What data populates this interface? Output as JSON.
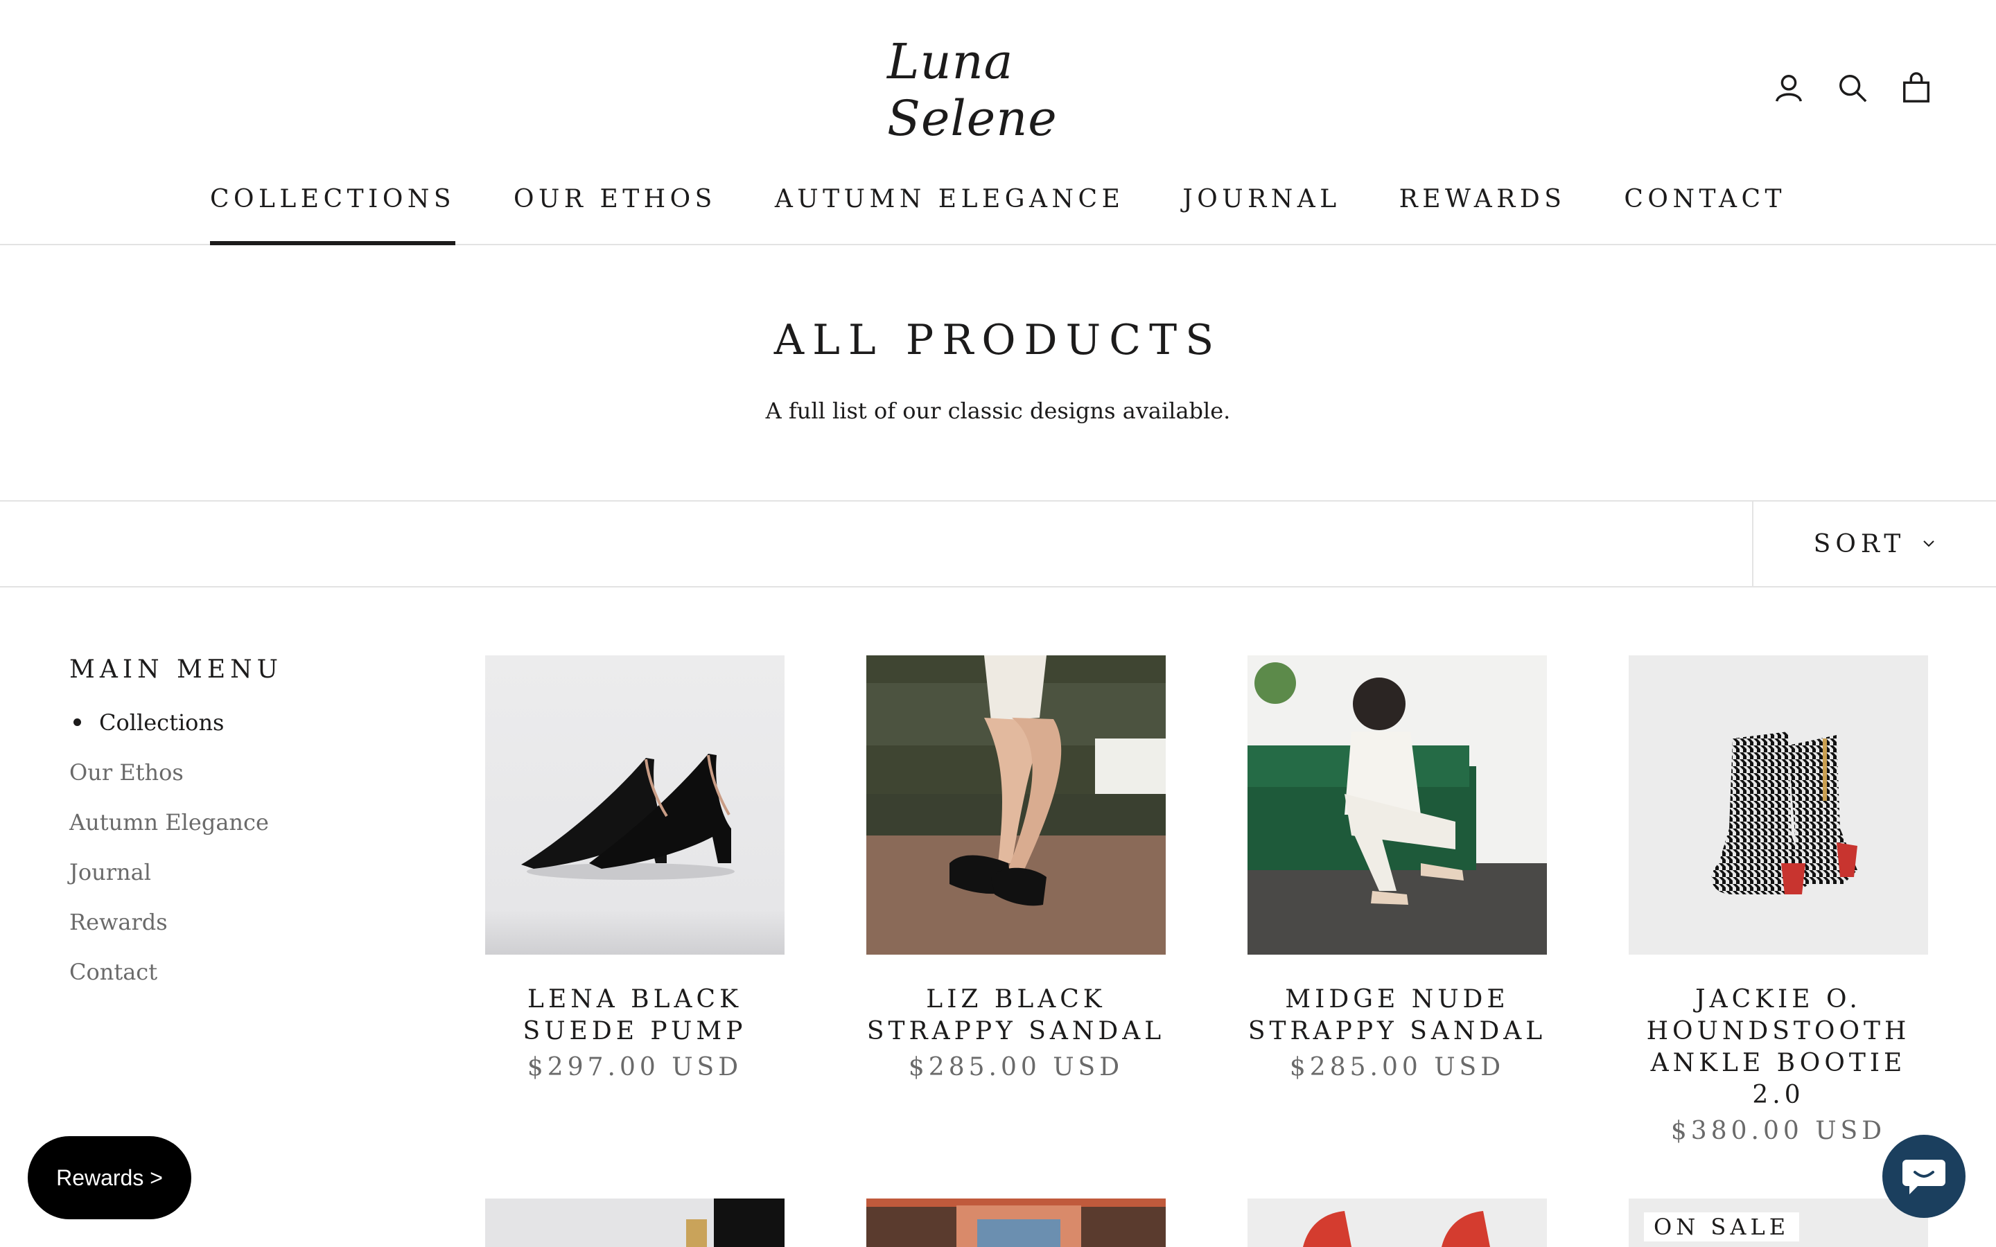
{
  "header": {
    "logo_text": "Luna Selene",
    "icons": [
      "account-icon",
      "search-icon",
      "cart-icon"
    ]
  },
  "nav": {
    "items": [
      {
        "label": "COLLECTIONS",
        "active": true
      },
      {
        "label": "OUR ETHOS",
        "active": false
      },
      {
        "label": "AUTUMN ELEGANCE",
        "active": false
      },
      {
        "label": "JOURNAL",
        "active": false
      },
      {
        "label": "REWARDS",
        "active": false
      },
      {
        "label": "CONTACT",
        "active": false
      }
    ]
  },
  "collection": {
    "title": "ALL PRODUCTS",
    "description": "A full list of our classic designs available."
  },
  "toolbar": {
    "sort_label": "SORT"
  },
  "sidebar": {
    "title": "MAIN MENU",
    "items": [
      {
        "label": "Collections",
        "active": true
      },
      {
        "label": "Our Ethos",
        "active": false
      },
      {
        "label": "Autumn Elegance",
        "active": false
      },
      {
        "label": "Journal",
        "active": false
      },
      {
        "label": "Rewards",
        "active": false
      },
      {
        "label": "Contact",
        "active": false
      }
    ]
  },
  "products": [
    {
      "name": "LENA BLACK SUEDE PUMP",
      "price": "$297.00 USD"
    },
    {
      "name": "LIZ BLACK STRAPPY SANDAL",
      "price": "$285.00 USD"
    },
    {
      "name": "MIDGE NUDE STRAPPY SANDAL",
      "price": "$285.00 USD"
    },
    {
      "name": "JACKIE O. HOUNDSTOOTH ANKLE BOOTIE 2.0",
      "price": "$380.00 USD"
    }
  ],
  "partial_row": {
    "badge": "ON SALE"
  },
  "widgets": {
    "rewards_label": "Rewards >"
  },
  "colors": {
    "text": "#1c1b1b",
    "muted": "#6a6a6a",
    "border": "#e3e3e3",
    "chat": "#1b3f5e"
  }
}
